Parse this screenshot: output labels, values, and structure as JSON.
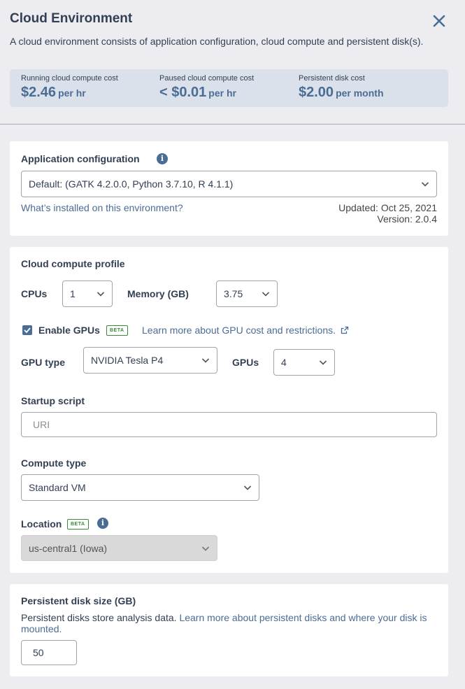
{
  "header": {
    "title": "Cloud Environment",
    "description": "A cloud environment consists of application configuration, cloud compute and persistent disk(s)."
  },
  "costs": {
    "running": {
      "label": "Running cloud compute cost",
      "value": "$2.46",
      "unit": "per hr"
    },
    "paused": {
      "label": "Paused cloud compute cost",
      "value": "< $0.01",
      "unit": "per hr"
    },
    "disk": {
      "label": "Persistent disk cost",
      "value": "$2.00",
      "unit": "per month"
    }
  },
  "app_config": {
    "label": "Application configuration",
    "selected": "Default: (GATK 4.2.0.0, Python 3.7.10, R 4.1.1)",
    "link": "What’s installed on this environment?",
    "updated": "Updated: Oct 25, 2021",
    "version": "Version: 2.0.4"
  },
  "compute": {
    "section_title": "Cloud compute profile",
    "cpus_label": "CPUs",
    "cpus_value": "1",
    "memory_label": "Memory (GB)",
    "memory_value": "3.75",
    "enable_gpus_label": "Enable GPUs",
    "enable_gpus_checked": true,
    "beta_badge": "BETA",
    "gpu_link": "Learn more about GPU cost and restrictions.",
    "gpu_type_label": "GPU type",
    "gpu_type_value": "NVIDIA Tesla P4",
    "gpus_label": "GPUs",
    "gpus_value": "4",
    "startup_label": "Startup script",
    "startup_placeholder": "URI",
    "compute_type_label": "Compute type",
    "compute_type_value": "Standard VM",
    "location_label": "Location",
    "location_value": "us-central1 (Iowa)"
  },
  "disk": {
    "label": "Persistent disk size (GB)",
    "description": "Persistent disks store analysis data.",
    "link": "Learn more about persistent disks and where your disk is mounted.",
    "size_value": "50"
  },
  "colors": {
    "accent": "#4a6c95",
    "text": "#333f52",
    "beta": "#3a8a3a",
    "background": "#ededf1",
    "cost_bar": "#dbe1ea"
  }
}
